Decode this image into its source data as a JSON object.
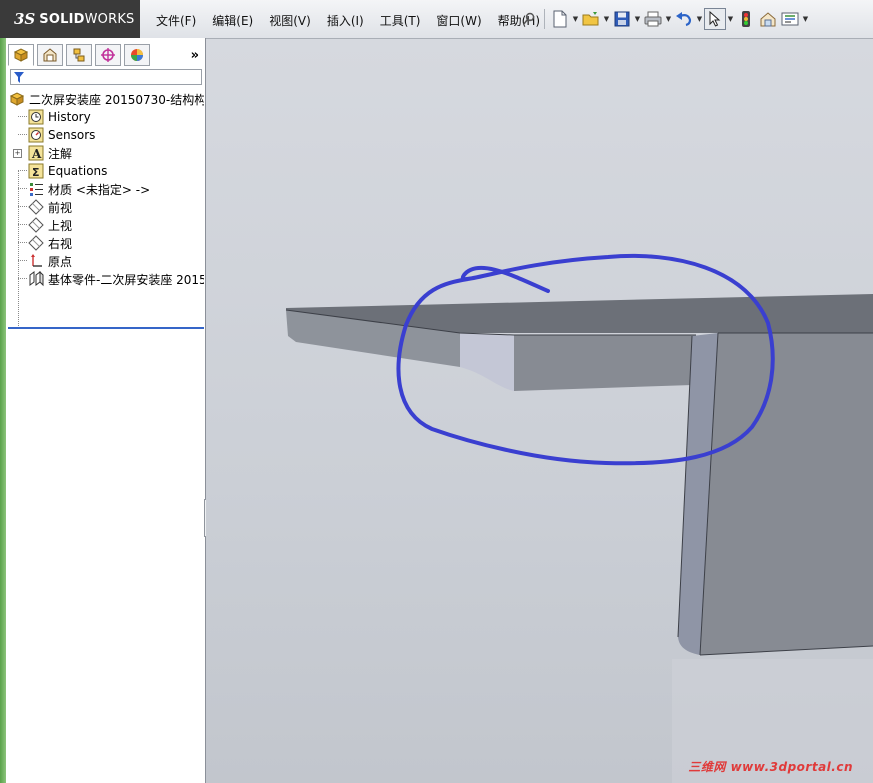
{
  "app": {
    "logo_mark": "3S",
    "logo_text_bold": "SOLID",
    "logo_text_light": "WORKS"
  },
  "menu": {
    "items": [
      "文件(F)",
      "编辑(E)",
      "视图(V)",
      "插入(I)",
      "工具(T)",
      "窗口(W)",
      "帮助(H)"
    ]
  },
  "toolbar": {
    "buttons": [
      "pin-icon",
      "new-document-icon",
      "open-folder-icon",
      "save-icon",
      "print-icon",
      "undo-icon",
      "select-cursor-icon",
      "traffic-light-icon",
      "options-icon",
      "customize-icon"
    ]
  },
  "panel": {
    "more_glyph": "»",
    "tabs": [
      "feature-manager-icon",
      "property-manager-icon",
      "configuration-manager-icon",
      "dim-xpert-icon",
      "display-manager-icon"
    ]
  },
  "tree": {
    "root": "二次屏安装座 20150730-结构构",
    "items": [
      {
        "label": "History",
        "icon": "history-icon",
        "expandable": false
      },
      {
        "label": "Sensors",
        "icon": "sensors-icon",
        "expandable": false
      },
      {
        "label": "注解",
        "icon": "annotations-icon",
        "expandable": true
      },
      {
        "label": "Equations",
        "icon": "equations-icon",
        "expandable": false
      },
      {
        "label": "材质 <未指定> ->",
        "icon": "material-icon",
        "expandable": false
      },
      {
        "label": "前视",
        "icon": "plane-icon",
        "expandable": false
      },
      {
        "label": "上视",
        "icon": "plane-icon",
        "expandable": false
      },
      {
        "label": "右视",
        "icon": "plane-icon",
        "expandable": false
      },
      {
        "label": "原点",
        "icon": "origin-icon",
        "expandable": false
      },
      {
        "label": "基体零件-二次屏安装座 2015",
        "icon": "sheetmetal-part-icon",
        "expandable": false
      }
    ]
  },
  "viewport": {
    "watermark_a": "三维网",
    "watermark_b": "www.3dportal.cn"
  },
  "colors": {
    "annotation_stroke": "#3a3fd0",
    "model_top": "#6c7078",
    "model_side": "#8e939b",
    "model_front": "#878b93",
    "panel_accent": "#59a24a"
  }
}
